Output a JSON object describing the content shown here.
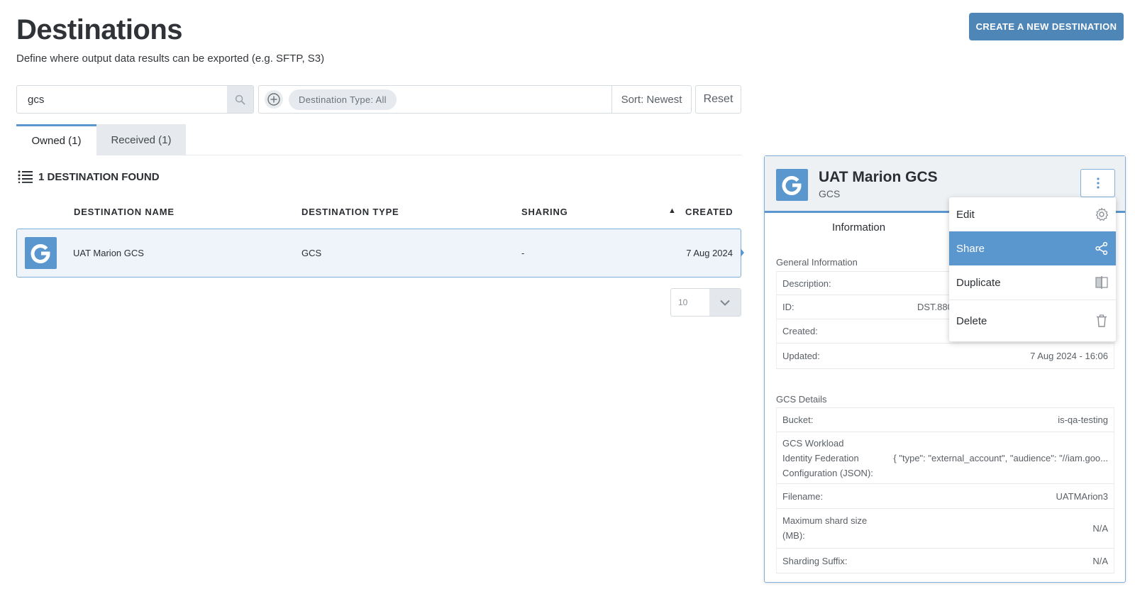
{
  "page": {
    "title": "Destinations",
    "subtitle": "Define where output data results can be exported (e.g. SFTP, S3)",
    "create_button": "CREATE A NEW DESTINATION"
  },
  "search": {
    "value": "gcs",
    "placeholder": ""
  },
  "filters": {
    "chip": "Destination Type: All",
    "sort": "Sort: Newest",
    "reset": "Reset"
  },
  "tabs": [
    {
      "label": "Owned (1)",
      "active": true
    },
    {
      "label": "Received (1)",
      "active": false
    }
  ],
  "results": {
    "count_label": "1 DESTINATION FOUND",
    "columns": [
      "DESTINATION NAME",
      "DESTINATION TYPE",
      "SHARING",
      "CREATED"
    ],
    "rows": [
      {
        "logo_letter": "G",
        "name": "UAT Marion GCS",
        "type": "GCS",
        "sharing": "-",
        "created": "7 Aug 2024"
      }
    ]
  },
  "pager": {
    "page_size": "10"
  },
  "panel": {
    "logo_letter": "G",
    "title": "UAT Marion GCS",
    "type": "GCS",
    "tab": "Information",
    "general_title": "General Information",
    "general": [
      {
        "key": "Description:",
        "value": ""
      },
      {
        "key": "ID:",
        "value": "DST.880"
      },
      {
        "key": "Created:",
        "value": ""
      },
      {
        "key": "Updated:",
        "value": "7 Aug 2024 - 16:06"
      }
    ],
    "gcs_title": "GCS Details",
    "gcs": {
      "bucket_key": "Bucket:",
      "bucket_value": "is-qa-testing",
      "wif_key_1": "GCS Workload",
      "wif_key_2": "Identity Federation",
      "wif_key_3": "Configuration (JSON):",
      "wif_value": "{ \"type\": \"external_account\", \"audience\": \"//iam.goo...",
      "filename_key": "Filename:",
      "filename_value": "UATMArion3",
      "shard_key_1": "Maximum shard size",
      "shard_key_2": "(MB):",
      "shard_value": "N/A",
      "suffix_key": "Sharding Suffix:",
      "suffix_value": "N/A"
    }
  },
  "menu": {
    "items": [
      {
        "label": "Edit",
        "icon": "gear-icon"
      },
      {
        "label": "Share",
        "icon": "share-icon",
        "active": true
      },
      {
        "label": "Duplicate",
        "icon": "duplicate-icon"
      },
      {
        "label": "Delete",
        "icon": "trash-icon"
      }
    ]
  },
  "colors": {
    "accent": "#5a97cf",
    "button": "#4f86b8",
    "selected_row": "#eef4f9"
  }
}
